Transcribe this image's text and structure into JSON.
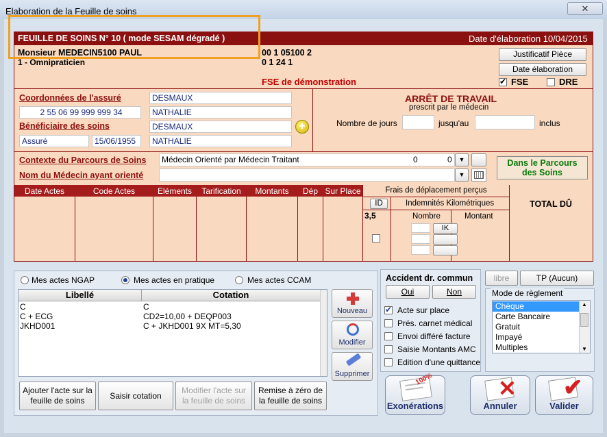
{
  "window": {
    "title": "Elaboration de la Feuille de soins",
    "close": "✕"
  },
  "sheet": {
    "title": "FEUILLE DE SOINS  N° 10 ( mode SESAM dégradé )",
    "date_label": "Date d'élaboration 10/04/2015",
    "doctor_name": "Monsieur MEDECIN5100 PAUL",
    "doctor_type": "1 - Omnipraticien",
    "doctor_num1": "00 1 05100 2",
    "doctor_num2": "0 1 24 1",
    "demo_label": "FSE de démonstration",
    "btn_justificatif": "Justificatif Pièce",
    "btn_date_elab": "Date élaboration",
    "chk_fse": "FSE",
    "chk_dre": "DRE"
  },
  "assure": {
    "coord_label": "Coordonnées de l'assuré",
    "nir": "2 55 06 99 999 999 34",
    "nom": "DESMAUX",
    "prenom": "NATHALIE",
    "benef_label": "Bénéficiaire des soins",
    "benef_nom": "DESMAUX",
    "benef_prenom": "NATHALIE",
    "qualite": "Assuré",
    "naissance": "15/06/1955"
  },
  "arret": {
    "title": "ARRÊT DE TRAVAIL",
    "subtitle": "prescrit par le médecin",
    "jours_label": "Nombre de jours",
    "jusquau_label": "jusqu'au",
    "inclus_label": "inclus"
  },
  "parcours": {
    "contexte_label": "Contexte du Parcours de Soins",
    "contexte_value": "Médecin Orienté par Médecin Traitant",
    "contexte_n1": "0",
    "contexte_n2": "0",
    "medecin_label": "Nom du Médecin ayant orienté",
    "badge_line1": "Dans le Parcours",
    "badge_line2": "des Soins"
  },
  "actes_table": {
    "headers": [
      "Date Actes",
      "Code Actes",
      "Eléments",
      "Tarification",
      "Montants",
      "Dép",
      "Sur Place"
    ],
    "frais_title": "Frais de déplacement perçus",
    "id_label": "ID",
    "ik_title": "Indemnités Kilométriques",
    "id_value": "3,5",
    "nombre_label": "Nombre",
    "montant_label": "Montant",
    "ik_btn": "IK",
    "total_label": "TOTAL DÛ"
  },
  "actes_panel": {
    "radio_ngap": "Mes actes NGAP",
    "radio_pratique": "Mes actes en pratique",
    "radio_ccam": "Mes actes CCAM",
    "col_libelle": "Libellé",
    "col_cotation": "Cotation",
    "rows": [
      {
        "libelle": "C",
        "cotation": "C"
      },
      {
        "libelle": "C + ECG",
        "cotation": "CD2=10,00 + DEQP003"
      },
      {
        "libelle": "JKHD001",
        "cotation": "C + JKHD001  9X   MT=5,30"
      }
    ],
    "btn_nouveau": "Nouveau",
    "btn_modifier": "Modifier",
    "btn_supprimer": "Supprimer"
  },
  "bottom_buttons": {
    "ajouter_l1": "Ajouter l'acte sur la",
    "ajouter_l2": "feuille de soins",
    "saisir": "Saisir cotation",
    "modifier_l1": "Modifier l'acte sur",
    "modifier_l2": "la feuille de soins",
    "remise_l1": "Remise à zéro de",
    "remise_l2": "la feuille de soins"
  },
  "accident": {
    "title": "Accident dr. commun",
    "oui": "Oui",
    "non": "Non"
  },
  "options": [
    {
      "label": "Acte sur place",
      "checked": true
    },
    {
      "label": "Prés. carnet médical",
      "checked": false
    },
    {
      "label": "Envoi différé facture",
      "checked": false
    },
    {
      "label": "Saisie Montants AMC",
      "checked": false
    },
    {
      "label": "Edition d'une quittance",
      "checked": false
    }
  ],
  "reglement": {
    "btn_libre": "libre",
    "btn_tp": "TP (Aucun)",
    "title": "Mode de règlement",
    "items": [
      "Chèque",
      "Carte Bancaire",
      "Gratuit",
      "Impayé",
      "Multiples"
    ],
    "selected": "Chèque"
  },
  "actions": {
    "exonerations": "Exonérations",
    "annuler": "Annuler",
    "valider": "Valider",
    "stamp_text": "100%"
  },
  "colors": {
    "brand_red": "#8b1010",
    "sheet_bg": "#f9d9c0",
    "selection": "#3399ff",
    "highlight": "#f0a020"
  }
}
